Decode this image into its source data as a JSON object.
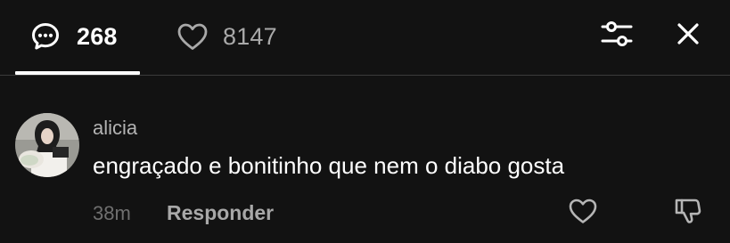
{
  "header": {
    "comments_count": "268",
    "likes_count": "8147",
    "comments_icon": "comment-bubble-icon",
    "likes_icon": "heart-outline-icon",
    "filter_icon": "sliders-icon",
    "close_icon": "close-icon"
  },
  "comment": {
    "username": "alicia",
    "text": "engraçado e bonitinho que nem o diabo gosta",
    "time": "38m",
    "reply_label": "Responder",
    "like_icon": "heart-outline-icon",
    "dislike_icon": "thumbs-down-icon"
  },
  "colors": {
    "background": "#121212",
    "primary_text": "#ffffff",
    "secondary_text": "#a8a8a8",
    "muted_text": "#6f6f6f",
    "divider": "#3a3a3a"
  }
}
